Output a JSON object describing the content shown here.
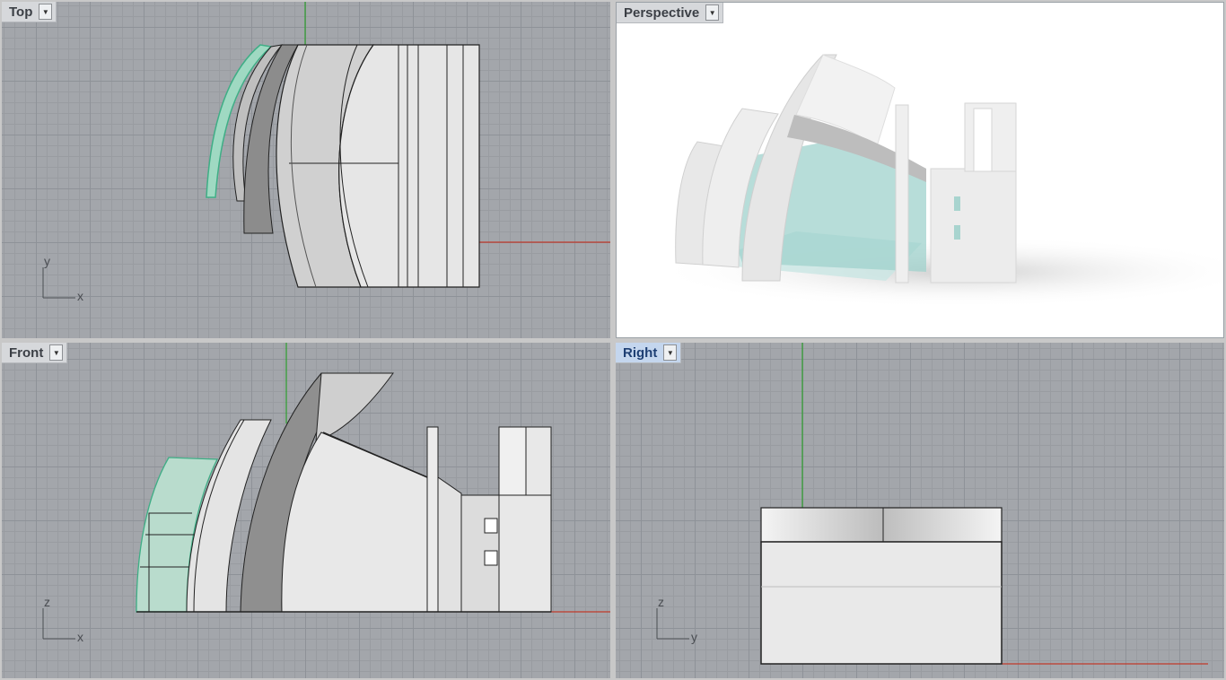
{
  "viewports": {
    "top": {
      "label": "Top",
      "axes": {
        "h": "x",
        "v": "y"
      }
    },
    "perspective": {
      "label": "Perspective"
    },
    "front": {
      "label": "Front",
      "axes": {
        "h": "x",
        "v": "z"
      }
    },
    "right": {
      "label": "Right",
      "axes": {
        "h": "y",
        "v": "z"
      },
      "active": true
    }
  },
  "icons": {
    "viewport_menu": "chevron-down-icon"
  },
  "colors": {
    "viewport_bg": "#a3a6ab",
    "perspective_bg": "#ffffff",
    "x_axis": "#c0392b",
    "y_axis": "#2e9e2e",
    "selection": "#7fd0b2",
    "glass": "#8fc9c4",
    "active_label_bg": "#c4d6ee"
  }
}
